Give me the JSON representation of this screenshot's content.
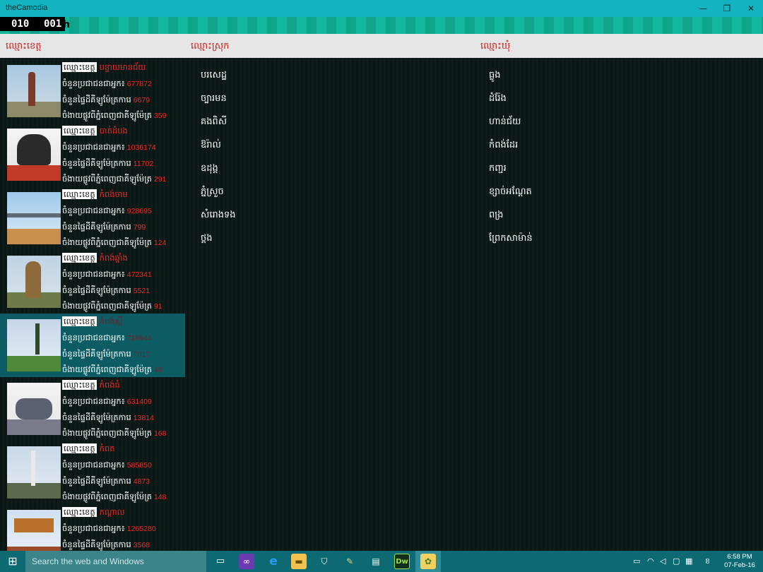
{
  "window": {
    "title": "theCamodia",
    "minimize": "—",
    "maximize": "❐",
    "close": "✕"
  },
  "header": {
    "clock_h": "010",
    "clock_m": "001",
    "clock_suffix": "h"
  },
  "columns": {
    "province": "ឈ្មោះខេត្ត",
    "district": "ឈ្មោះស្រុក",
    "commune": "ឈ្មោះឃុំ"
  },
  "labels": {
    "name": "ឈ្មោះខេត្ត",
    "population": "ចំនួនប្រជាជនជាអ្នក៖",
    "area": "ចំនួនផ្ទៃដីគីឡូម៉ែត្រការេ",
    "distance": "ចំងាយផ្លូវពីភ្នំពេញជាគីឡូម៉ែត្រ"
  },
  "provinces": [
    {
      "name": "បន្ទាយមានជ័យ",
      "population": "677872",
      "area": "6679",
      "distance": "359"
    },
    {
      "name": "បាត់ដំបង",
      "population": "1036174",
      "area": "11702",
      "distance": "291"
    },
    {
      "name": "កំពង់ចាម",
      "population": "928695",
      "area": "799",
      "distance": "124"
    },
    {
      "name": "កំពង់ឆ្នាំង",
      "population": "472341",
      "area": "5521",
      "distance": "91"
    },
    {
      "name": "កំពង់ស្ពឺ",
      "population": "716944",
      "area": "7017",
      "distance": "48"
    },
    {
      "name": "កំពង់ធំ",
      "population": "631409",
      "area": "13814",
      "distance": "168"
    },
    {
      "name": "កំពត",
      "population": "585850",
      "area": "4873",
      "distance": "148"
    },
    {
      "name": "កណ្ដាល",
      "population": "1265280",
      "area": "3568",
      "distance": ""
    }
  ],
  "districts": [
    "បរសេដ្ឋ",
    "ច្បារមន",
    "គងពិសី",
    "ឱរ៉ាល់",
    "ឧដុង្គ",
    "ភ្នំស្រួច",
    "សំរោងទង",
    "ថ្ពង"
  ],
  "communes": [
    "ធ្លូង",
    "ដំរ៉ែង",
    "ហាន់ជ័យ",
    "កំពង់ដែរ",
    "កញ្ជរ",
    "ខ្សាច់អណ្ដែត",
    "ពង្រ",
    "ព្រែកសាម៉ាន់"
  ],
  "taskbar": {
    "search_placeholder": "Search the web and Windows",
    "time": "6:58 PM",
    "date": "07-Feb-16"
  },
  "colors": {
    "titlebar": "#13b3bf",
    "accent": "#12b89d",
    "selected": "#0c5d63",
    "value_red": "#ef2a2a",
    "taskbar": "#0d6a73"
  }
}
